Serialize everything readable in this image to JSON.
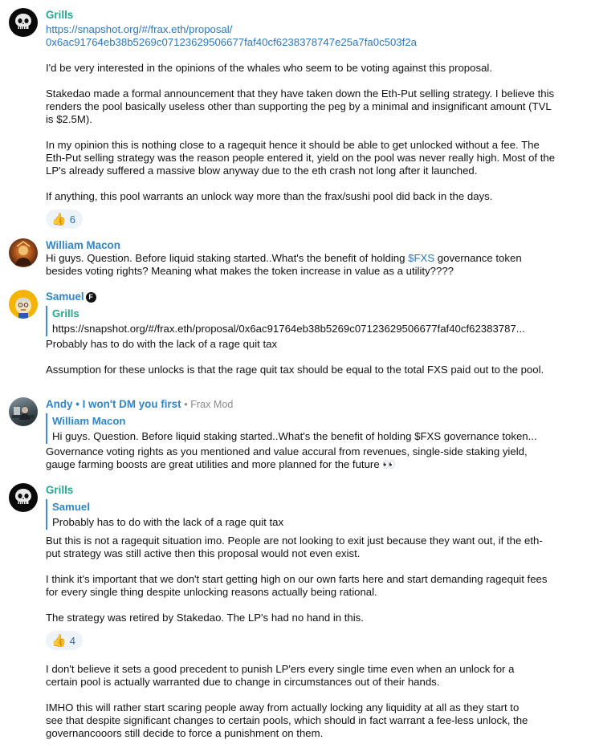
{
  "messages": [
    {
      "author": "Grills",
      "link": "https://snapshot.org/#/frax.eth/proposal/0x6ac91764eb38b5269c07123629506677faf40cf6238378747e25a7fa0c503f2a",
      "link_line1": "https://snapshot.org/#/frax.eth/proposal/",
      "link_line2": "0x6ac91764eb38b5269c07123629506677faf40cf6238378747e25a7fa0c503f2a",
      "paragraphs": [
        "I'd be very interested in the opinions of the whales who seem to be voting against this proposal.",
        "Stakedao made a formal announcement that they have taken down the Eth-Put selling strategy. I believe this renders the pool basically useless other than supporting the peg by a minimal and insignificant amount (TVL is $2.5M).",
        "In my opinion this is nothing close to a ragequit hence it should be able to get unlocked without a fee. The Eth-Put selling strategy was the reason people entered it, yield on the pool was never really high. Most of the LP's already suffered a massive blow anyway due to the eth crash not long after it launched.",
        "If anything, this pool warrants an unlock way more than the frax/sushi pool did back in the days."
      ],
      "reaction": {
        "emoji": "thumbs-up",
        "count": "6"
      }
    },
    {
      "author": "William Macon",
      "text_before": "Hi guys. Question. Before liquid staking started..What's the benefit of holding ",
      "token": "$FXS",
      "text_after": " governance token besides voting rights? Meaning what makes the token increase in value as a utility????"
    },
    {
      "author": "Samuel",
      "badge": "F",
      "reply": {
        "author": "Grills",
        "text": "https://snapshot.org/#/frax.eth/proposal/0x6ac91764eb38b5269c07123629506677faf40cf62383787..."
      },
      "paragraphs": [
        "Probably has to do with the lack of a rage quit tax",
        "Assumption for these unlocks is that the rage quit tax should be equal to the total FXS paid out to the pool."
      ]
    },
    {
      "author": "Andy • I won't DM you first",
      "role": "• Frax Mod",
      "reply": {
        "author": "William Macon",
        "text": "Hi guys. Question. Before liquid staking started..What's the benefit of holding $FXS governance token..."
      },
      "paragraphs": [
        "Governance voting rights as you mentioned and value accural from revenues, single-side staking yield, gauge farming boosts are great utilities and more planned for the future 👀"
      ]
    },
    {
      "author": "Grills",
      "reply": {
        "author": "Samuel",
        "text": "Probably has to do with the lack of a rage quit tax"
      },
      "paragraphs": [
        "But this is not a ragequit situation imo. People are not looking to exit just because they want out, if the eth-put strategy was still active then this proposal would not even exist.",
        "I think it's important that we don't start getting high on our own farts here and start demanding ragequit fees for every single thing despite unlocking reasons actually being rational.",
        "The strategy was retired by Stakedao. The LP's had no hand in this."
      ],
      "reaction": {
        "emoji": "thumbs-up",
        "count": "4"
      },
      "after_reaction": [
        "I don't believe it sets a good precedent to punish LP'ers every single time even when an unlock for a certain pool is actually warranted due to change in circumstances out of their hands.",
        "IMHO this will rather start scaring people away from actually locking any liquidity at all as they start to see that despite significant changes to certain pools, which should in fact warrant a fee-less unlock, the governancooors still decide to force a punishment on them."
      ]
    }
  ],
  "colors": {
    "grills": "#22a98e",
    "name_blue": "#2f86c8",
    "link": "#2a78c0",
    "reply_bar": "#3d8fd1",
    "reaction_bg": "#eef3fa"
  }
}
